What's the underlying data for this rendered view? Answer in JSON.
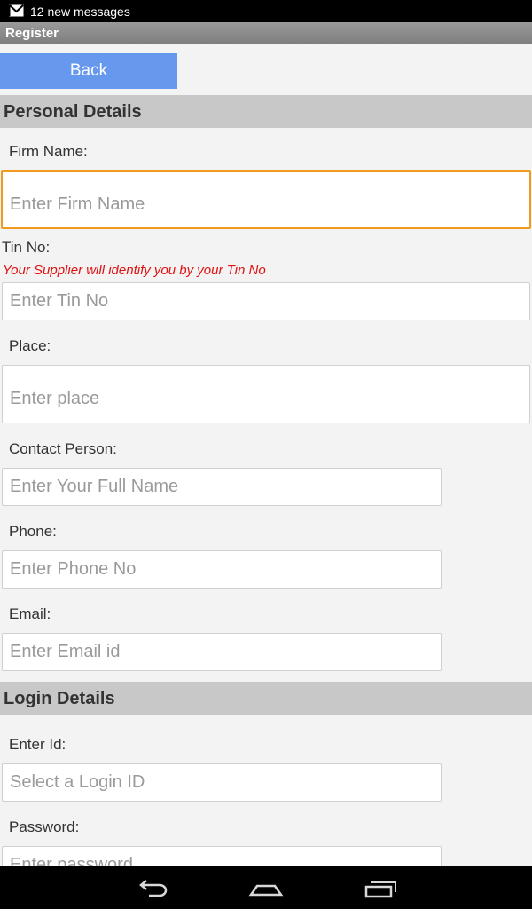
{
  "status_bar": {
    "notification_icon": "gmail-icon",
    "notification_text": "12 new messages"
  },
  "title_bar": {
    "title": "Register"
  },
  "back_button": {
    "label": "Back"
  },
  "personal_section": {
    "heading": "Personal Details",
    "firm_name": {
      "label": "Firm Name:",
      "placeholder": "Enter Firm Name",
      "value": ""
    },
    "tin_no": {
      "label": "Tin No:",
      "hint": "Your Supplier will identify you by your Tin No",
      "placeholder": "Enter Tin No",
      "value": ""
    },
    "place": {
      "label": "Place:",
      "placeholder": "Enter place",
      "value": ""
    },
    "contact_person": {
      "label": "Contact Person:",
      "placeholder": "Enter Your Full Name",
      "value": ""
    },
    "phone": {
      "label": "Phone:",
      "placeholder": "Enter Phone No",
      "value": ""
    },
    "email": {
      "label": "Email:",
      "placeholder": "Enter Email id",
      "value": ""
    }
  },
  "login_section": {
    "heading": "Login Details",
    "login_id": {
      "label": "Enter Id:",
      "placeholder": "Select a Login ID",
      "value": ""
    },
    "password": {
      "label": "Password:",
      "placeholder": "Enter password",
      "value": ""
    }
  },
  "nav_bar": {
    "back_icon": "back-arrow-icon",
    "home_icon": "home-icon",
    "recents_icon": "recent-apps-icon"
  },
  "colors": {
    "accent": "#6699ee",
    "focus": "#f39a1e",
    "hint": "#e01010",
    "section_bg": "#c8c8c8"
  }
}
